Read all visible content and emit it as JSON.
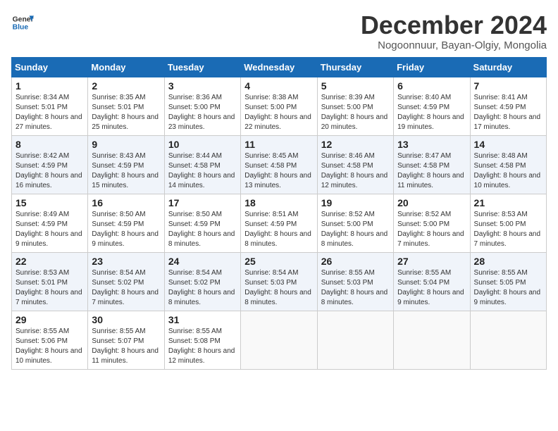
{
  "logo": {
    "line1": "General",
    "line2": "Blue"
  },
  "title": "December 2024",
  "location": "Nogoonnuur, Bayan-Olgiy, Mongolia",
  "days_of_week": [
    "Sunday",
    "Monday",
    "Tuesday",
    "Wednesday",
    "Thursday",
    "Friday",
    "Saturday"
  ],
  "weeks": [
    [
      {
        "day": "1",
        "sunrise": "8:34 AM",
        "sunset": "5:01 PM",
        "daylight": "8 hours and 27 minutes."
      },
      {
        "day": "2",
        "sunrise": "8:35 AM",
        "sunset": "5:01 PM",
        "daylight": "8 hours and 25 minutes."
      },
      {
        "day": "3",
        "sunrise": "8:36 AM",
        "sunset": "5:00 PM",
        "daylight": "8 hours and 23 minutes."
      },
      {
        "day": "4",
        "sunrise": "8:38 AM",
        "sunset": "5:00 PM",
        "daylight": "8 hours and 22 minutes."
      },
      {
        "day": "5",
        "sunrise": "8:39 AM",
        "sunset": "5:00 PM",
        "daylight": "8 hours and 20 minutes."
      },
      {
        "day": "6",
        "sunrise": "8:40 AM",
        "sunset": "4:59 PM",
        "daylight": "8 hours and 19 minutes."
      },
      {
        "day": "7",
        "sunrise": "8:41 AM",
        "sunset": "4:59 PM",
        "daylight": "8 hours and 17 minutes."
      }
    ],
    [
      {
        "day": "8",
        "sunrise": "8:42 AM",
        "sunset": "4:59 PM",
        "daylight": "8 hours and 16 minutes."
      },
      {
        "day": "9",
        "sunrise": "8:43 AM",
        "sunset": "4:59 PM",
        "daylight": "8 hours and 15 minutes."
      },
      {
        "day": "10",
        "sunrise": "8:44 AM",
        "sunset": "4:58 PM",
        "daylight": "8 hours and 14 minutes."
      },
      {
        "day": "11",
        "sunrise": "8:45 AM",
        "sunset": "4:58 PM",
        "daylight": "8 hours and 13 minutes."
      },
      {
        "day": "12",
        "sunrise": "8:46 AM",
        "sunset": "4:58 PM",
        "daylight": "8 hours and 12 minutes."
      },
      {
        "day": "13",
        "sunrise": "8:47 AM",
        "sunset": "4:58 PM",
        "daylight": "8 hours and 11 minutes."
      },
      {
        "day": "14",
        "sunrise": "8:48 AM",
        "sunset": "4:58 PM",
        "daylight": "8 hours and 10 minutes."
      }
    ],
    [
      {
        "day": "15",
        "sunrise": "8:49 AM",
        "sunset": "4:59 PM",
        "daylight": "8 hours and 9 minutes."
      },
      {
        "day": "16",
        "sunrise": "8:50 AM",
        "sunset": "4:59 PM",
        "daylight": "8 hours and 9 minutes."
      },
      {
        "day": "17",
        "sunrise": "8:50 AM",
        "sunset": "4:59 PM",
        "daylight": "8 hours and 8 minutes."
      },
      {
        "day": "18",
        "sunrise": "8:51 AM",
        "sunset": "4:59 PM",
        "daylight": "8 hours and 8 minutes."
      },
      {
        "day": "19",
        "sunrise": "8:52 AM",
        "sunset": "5:00 PM",
        "daylight": "8 hours and 8 minutes."
      },
      {
        "day": "20",
        "sunrise": "8:52 AM",
        "sunset": "5:00 PM",
        "daylight": "8 hours and 7 minutes."
      },
      {
        "day": "21",
        "sunrise": "8:53 AM",
        "sunset": "5:00 PM",
        "daylight": "8 hours and 7 minutes."
      }
    ],
    [
      {
        "day": "22",
        "sunrise": "8:53 AM",
        "sunset": "5:01 PM",
        "daylight": "8 hours and 7 minutes."
      },
      {
        "day": "23",
        "sunrise": "8:54 AM",
        "sunset": "5:02 PM",
        "daylight": "8 hours and 7 minutes."
      },
      {
        "day": "24",
        "sunrise": "8:54 AM",
        "sunset": "5:02 PM",
        "daylight": "8 hours and 8 minutes."
      },
      {
        "day": "25",
        "sunrise": "8:54 AM",
        "sunset": "5:03 PM",
        "daylight": "8 hours and 8 minutes."
      },
      {
        "day": "26",
        "sunrise": "8:55 AM",
        "sunset": "5:03 PM",
        "daylight": "8 hours and 8 minutes."
      },
      {
        "day": "27",
        "sunrise": "8:55 AM",
        "sunset": "5:04 PM",
        "daylight": "8 hours and 9 minutes."
      },
      {
        "day": "28",
        "sunrise": "8:55 AM",
        "sunset": "5:05 PM",
        "daylight": "8 hours and 9 minutes."
      }
    ],
    [
      {
        "day": "29",
        "sunrise": "8:55 AM",
        "sunset": "5:06 PM",
        "daylight": "8 hours and 10 minutes."
      },
      {
        "day": "30",
        "sunrise": "8:55 AM",
        "sunset": "5:07 PM",
        "daylight": "8 hours and 11 minutes."
      },
      {
        "day": "31",
        "sunrise": "8:55 AM",
        "sunset": "5:08 PM",
        "daylight": "8 hours and 12 minutes."
      },
      null,
      null,
      null,
      null
    ]
  ]
}
